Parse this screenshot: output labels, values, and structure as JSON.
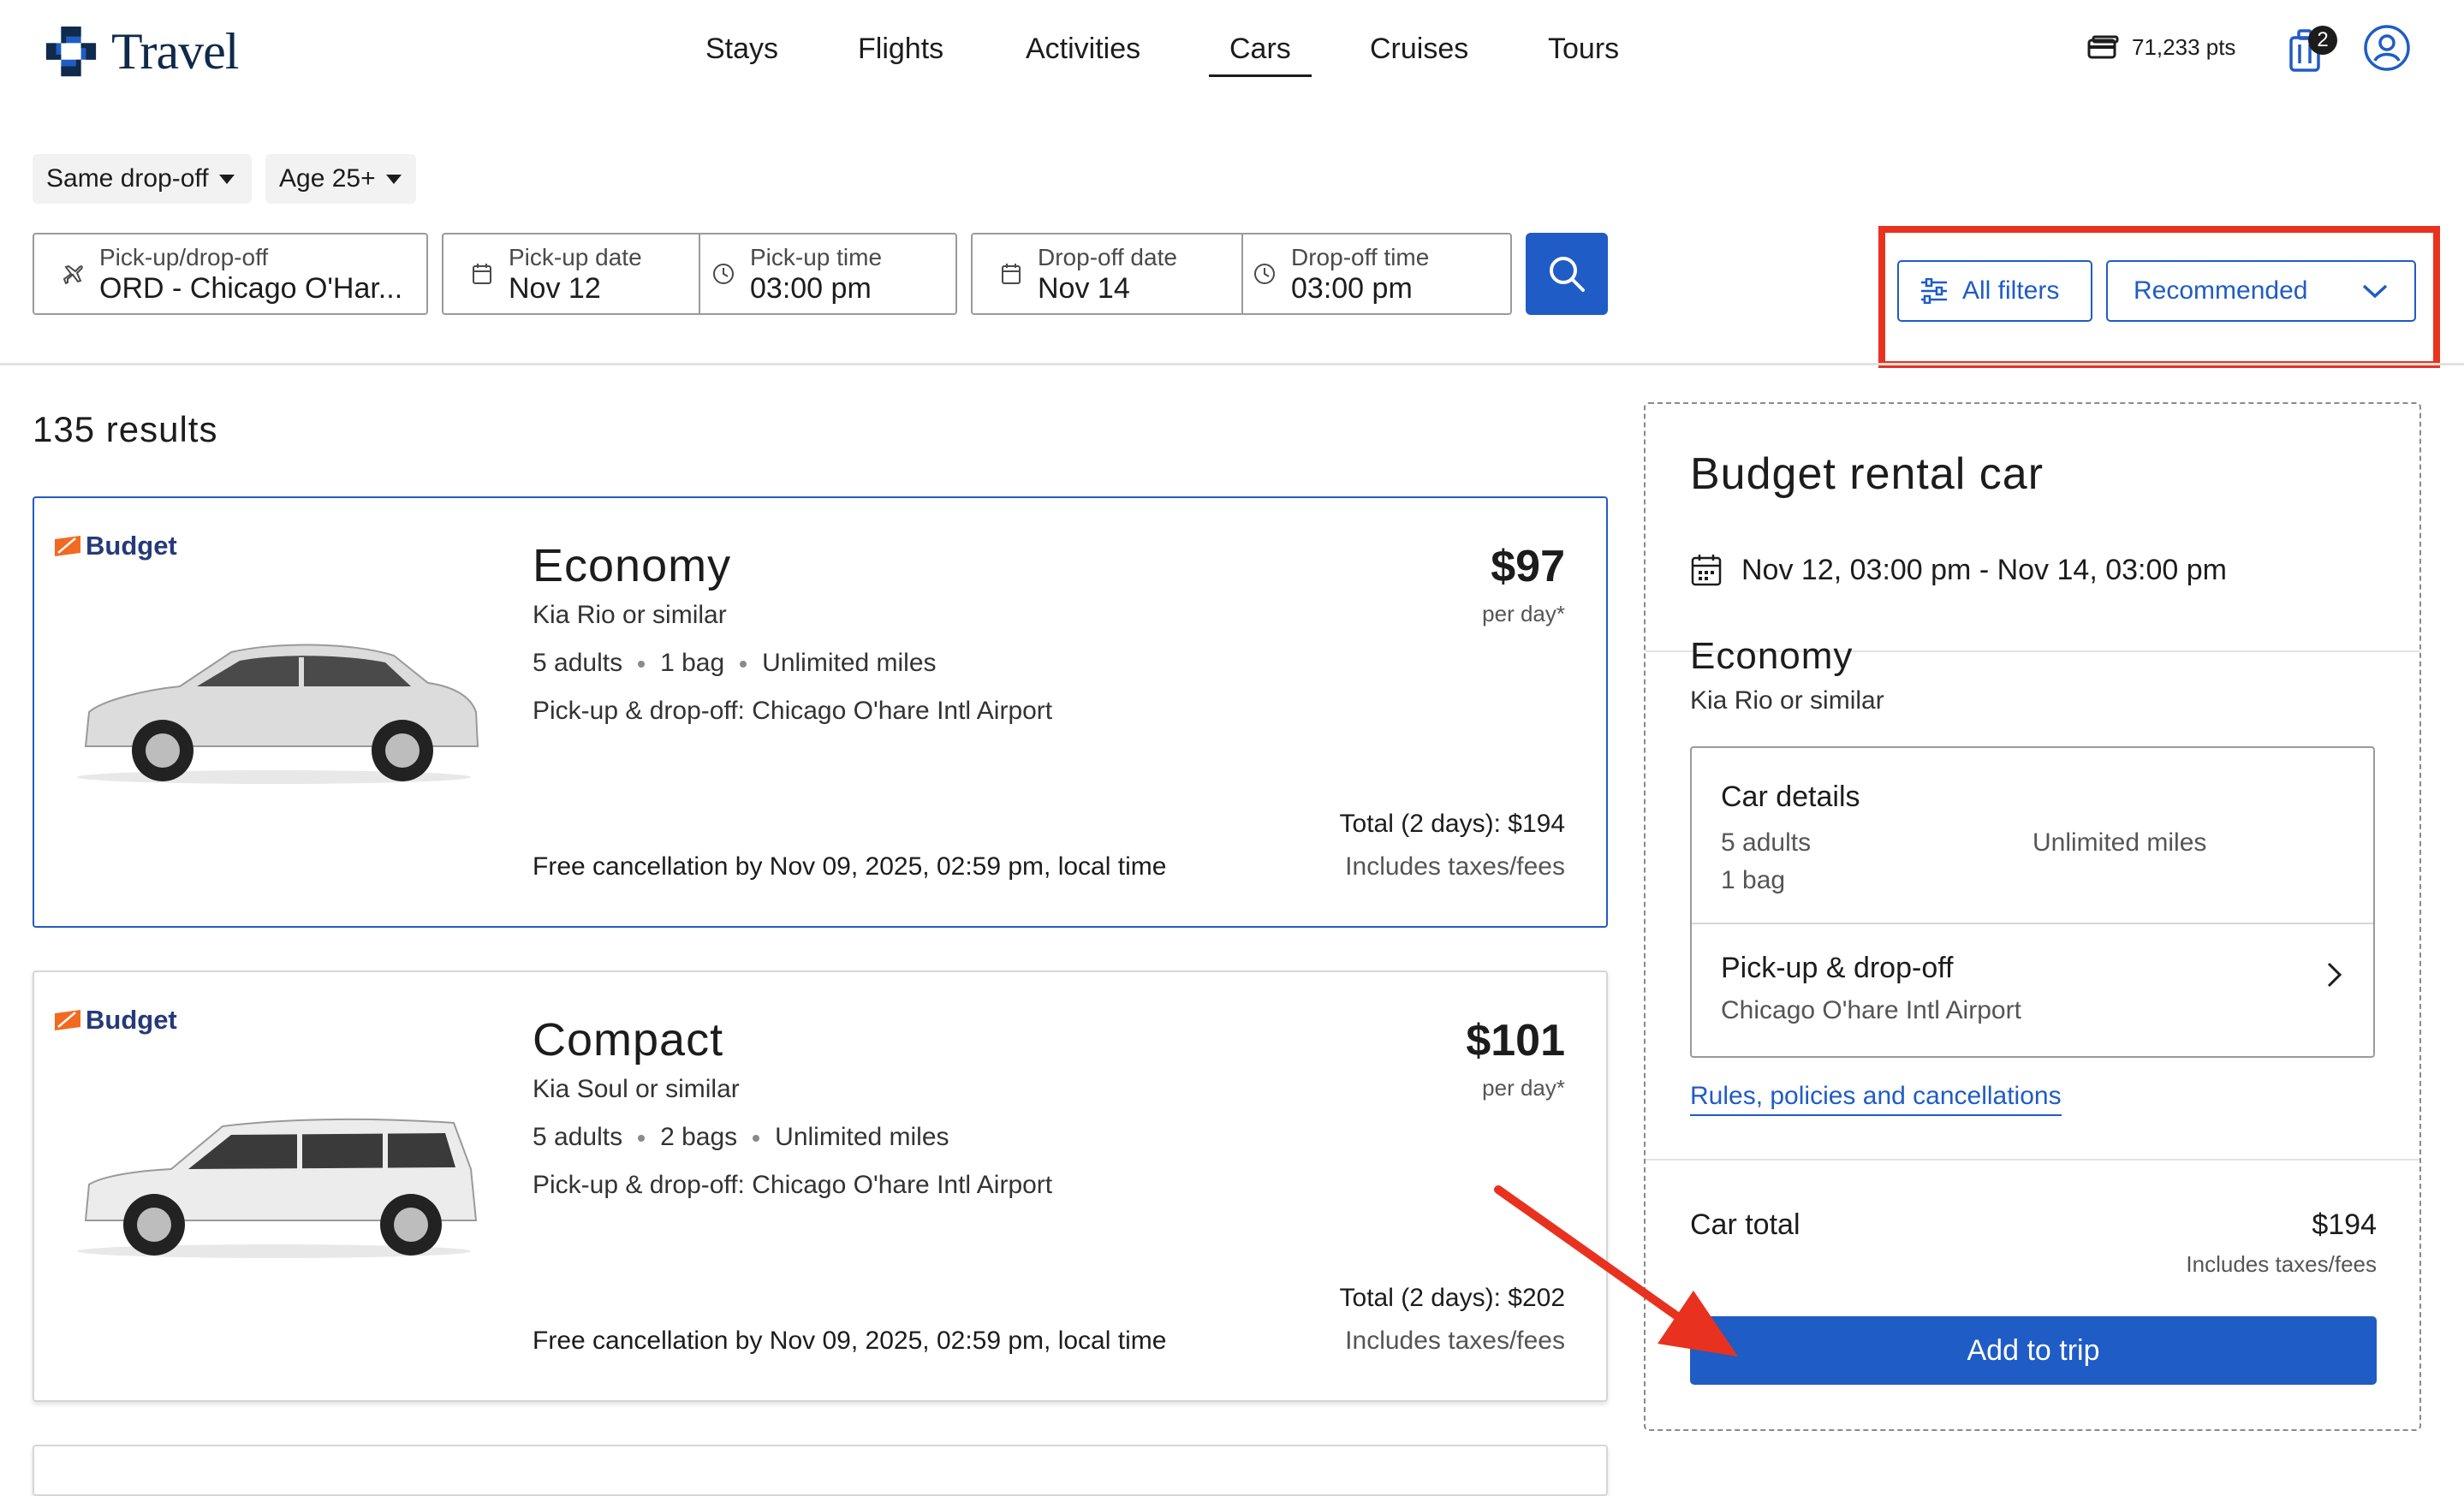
{
  "app": {
    "logo_text": "Travel",
    "accent_color": "#1f5cc5",
    "highlight_color": "#e8321f"
  },
  "nav": {
    "items": [
      {
        "label": "Stays",
        "active": false
      },
      {
        "label": "Flights",
        "active": false
      },
      {
        "label": "Activities",
        "active": false
      },
      {
        "label": "Cars",
        "active": true
      },
      {
        "label": "Cruises",
        "active": false
      },
      {
        "label": "Tours",
        "active": false
      }
    ],
    "points": "71,233 pts",
    "trip_badge": "2",
    "icons": {
      "points": "wallet-icon",
      "trip": "suitcase-icon",
      "profile": "profile-icon"
    }
  },
  "search": {
    "dropoff_chip": "Same drop-off",
    "age_chip": "Age 25+",
    "location_label": "Pick-up/drop-off",
    "location_value": "ORD - Chicago O'Har...",
    "pickup_date_label": "Pick-up date",
    "pickup_date_value": "Nov 12",
    "pickup_time_label": "Pick-up time",
    "pickup_time_value": "03:00 pm",
    "dropoff_date_label": "Drop-off date",
    "dropoff_date_value": "Nov 14",
    "dropoff_time_label": "Drop-off time",
    "dropoff_time_value": "03:00 pm",
    "all_filters_label": "All filters",
    "sort_value": "Recommended"
  },
  "results": {
    "count_label": "135 results",
    "cards": [
      {
        "brand": "Budget",
        "car_class": "Economy",
        "model": "Kia Rio or similar",
        "specs": [
          "5 adults",
          "1 bag",
          "Unlimited miles"
        ],
        "pickup": "Pick-up & drop-off: Chicago O'hare Intl Airport",
        "cancellation": "Free cancellation by Nov 09, 2025, 02:59 pm, local time",
        "price": "$97",
        "per_day": "per day*",
        "total": "Total (2 days): $194",
        "includes": "Includes taxes/fees",
        "selected": true
      },
      {
        "brand": "Budget",
        "car_class": "Compact",
        "model": "Kia Soul or similar",
        "specs": [
          "5 adults",
          "2 bags",
          "Unlimited miles"
        ],
        "pickup": "Pick-up & drop-off: Chicago O'hare Intl Airport",
        "cancellation": "Free cancellation by Nov 09, 2025, 02:59 pm, local time",
        "price": "$101",
        "per_day": "per day*",
        "total": "Total (2 days): $202",
        "includes": "Includes taxes/fees",
        "selected": false
      }
    ]
  },
  "panel": {
    "title": "Budget rental car",
    "dates": "Nov 12, 03:00 pm - Nov 14, 03:00 pm",
    "car_class": "Economy",
    "model": "Kia Rio or similar",
    "details_title": "Car details",
    "details_adults": "5 adults",
    "details_bags": "1 bag",
    "details_miles": "Unlimited miles",
    "pickup_title": "Pick-up & drop-off",
    "pickup_location": "Chicago O'hare Intl Airport",
    "rules_link": "Rules, policies and cancellations",
    "total_label": "Car total",
    "total_value": "$194",
    "total_includes": "Includes taxes/fees",
    "add_button": "Add to trip"
  }
}
